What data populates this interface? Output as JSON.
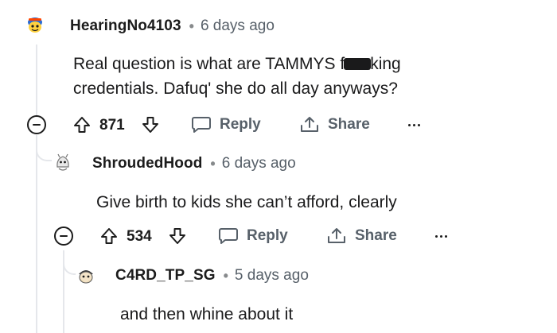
{
  "comments": [
    {
      "username": "HearingNo4103",
      "separator": "•",
      "time": "6 days ago",
      "text_line1_before": "Real question is what are TAMMYS f",
      "text_line1_after": "king",
      "text_line2": "credentials. Dafuq' she do all day anyways?",
      "score": "871",
      "reply_label": "Reply",
      "share_label": "Share"
    },
    {
      "username": "ShroudedHood",
      "separator": "•",
      "time": "6 days ago",
      "text": "Give birth to kids she can’t afford, clearly",
      "score": "534",
      "reply_label": "Reply",
      "share_label": "Share"
    },
    {
      "username": "C4RD_TP_SG",
      "separator": "•",
      "time": "5 days ago",
      "text": "and then whine about it"
    }
  ],
  "colors": {
    "text": "#1c1c1c",
    "muted": "#576069",
    "thread_line": "#e5e7eb",
    "avatar1_bg": "#ffd23f",
    "avatar1_accent": "#2b6cd4"
  }
}
